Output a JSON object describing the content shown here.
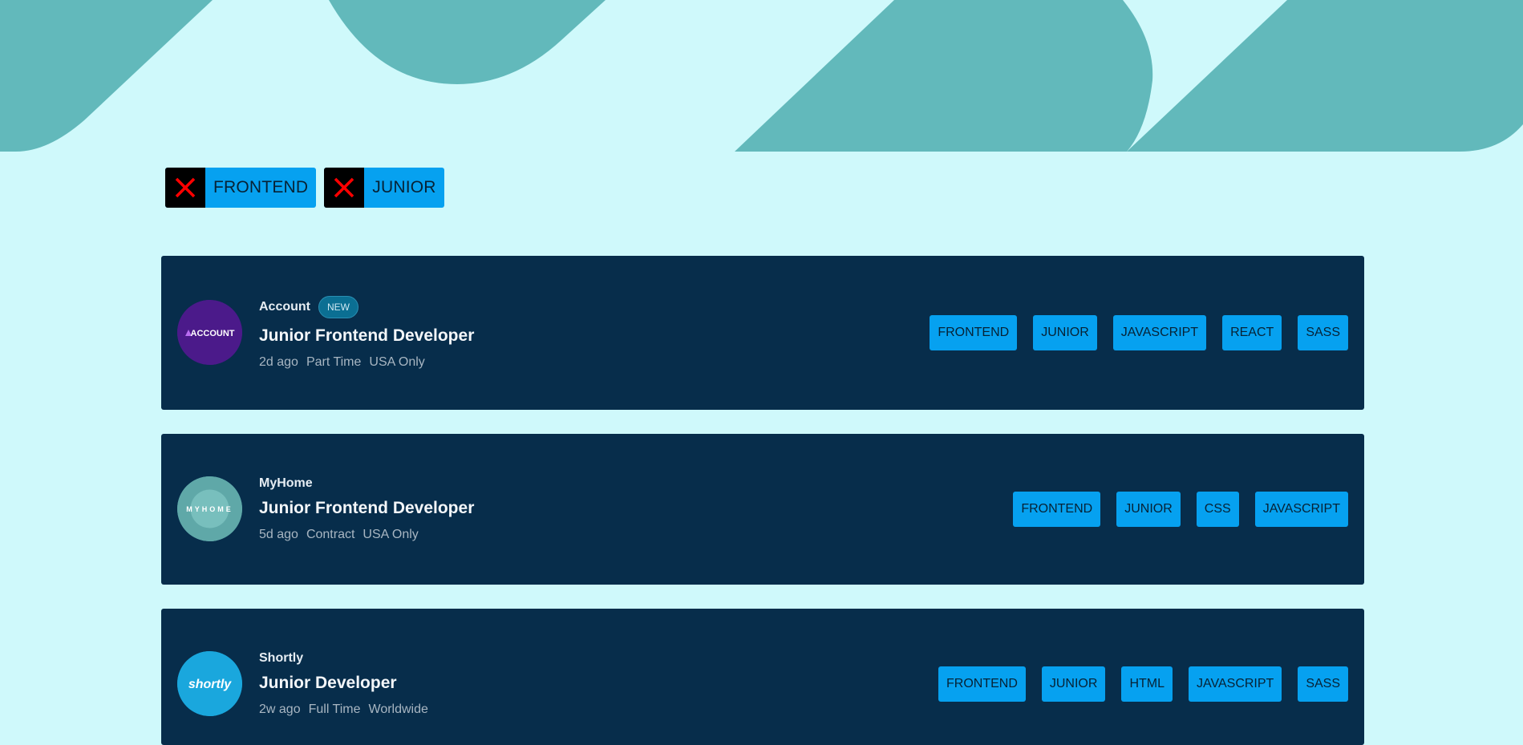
{
  "colors": {
    "page_bg": "#cff9fb",
    "hero_shape": "#62b9bb",
    "card_bg": "#072d4b",
    "tag_bg": "#06a1f0",
    "remove_x": "#ff0000"
  },
  "filters": [
    {
      "label": "FRONTEND",
      "remove_icon": "close-x-icon"
    },
    {
      "label": "JUNIOR",
      "remove_icon": "close-x-icon"
    }
  ],
  "jobs": [
    {
      "company": "Account",
      "badge": "NEW",
      "logo_text": "ACCOUNT",
      "logo_color": "#4b1a8a",
      "position": "Junior Frontend Developer",
      "posted": "2d ago",
      "contract": "Part Time",
      "location": "USA Only",
      "tags": [
        "FRONTEND",
        "JUNIOR",
        "JAVASCRIPT",
        "REACT",
        "SASS"
      ]
    },
    {
      "company": "MyHome",
      "badge": "",
      "logo_text": "MYHOME",
      "logo_color": "#62b9bb",
      "position": "Junior Frontend Developer",
      "posted": "5d ago",
      "contract": "Contract",
      "location": "USA Only",
      "tags": [
        "FRONTEND",
        "JUNIOR",
        "CSS",
        "JAVASCRIPT"
      ]
    },
    {
      "company": "Shortly",
      "badge": "",
      "logo_text": "shortly",
      "logo_color": "#1aa7dd",
      "position": "Junior Developer",
      "posted": "2w ago",
      "contract": "Full Time",
      "location": "Worldwide",
      "tags": [
        "FRONTEND",
        "JUNIOR",
        "HTML",
        "JAVASCRIPT",
        "SASS"
      ]
    }
  ]
}
